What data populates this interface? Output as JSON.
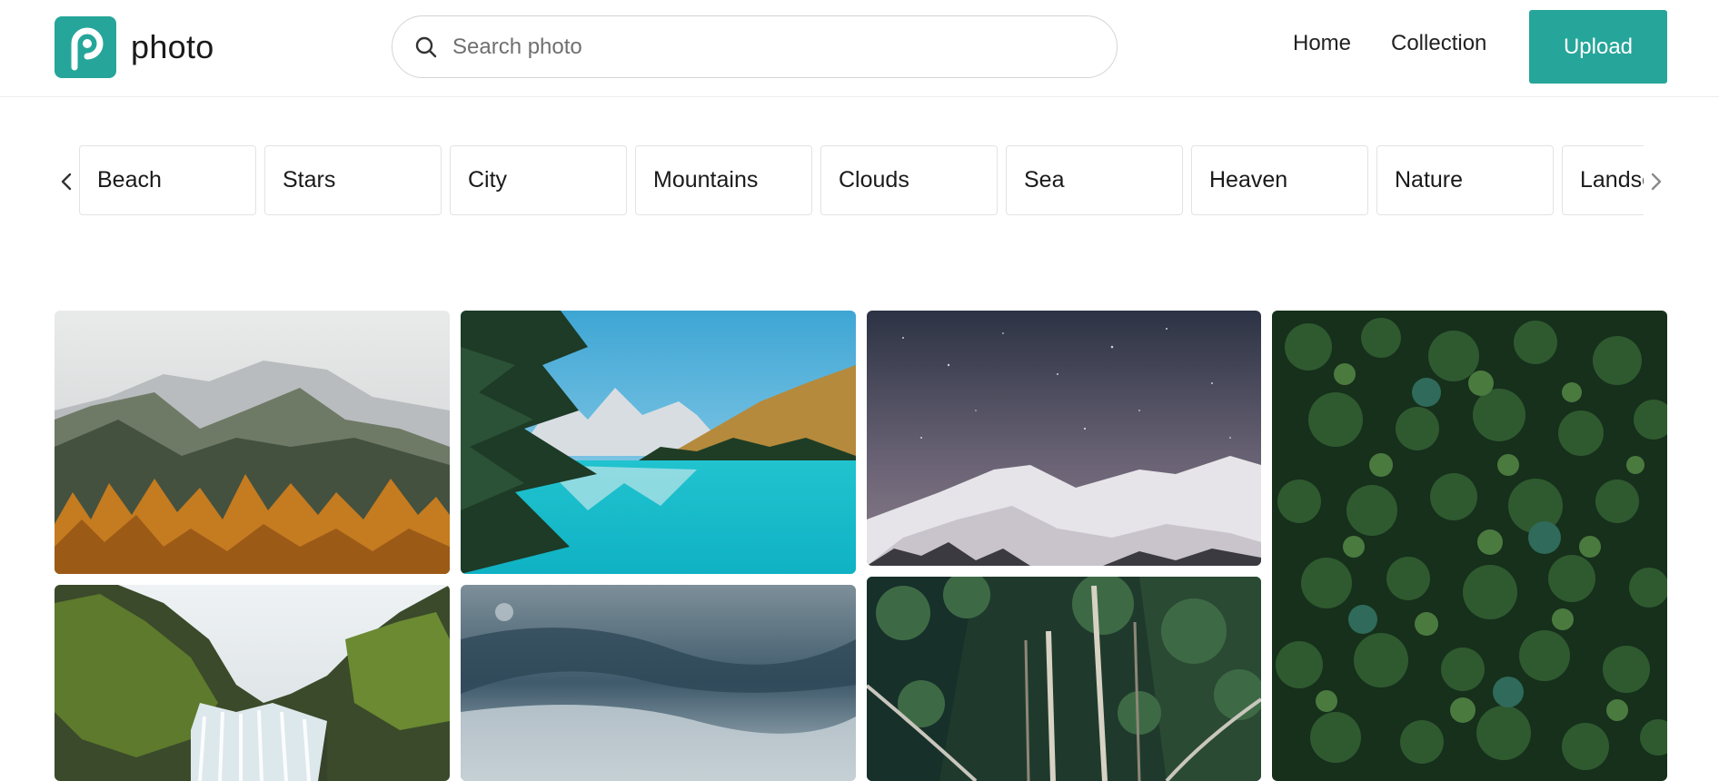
{
  "header": {
    "logo_text": "photo",
    "search_placeholder": "Search photo",
    "nav": {
      "home": "Home",
      "collection": "Collection"
    },
    "upload_label": "Upload"
  },
  "categories": [
    "Beach",
    "Stars",
    "City",
    "Mountains",
    "Clouds",
    "Sea",
    "Heaven",
    "Nature",
    "Landscape"
  ],
  "colors": {
    "accent": "#26a69a"
  },
  "icons": {
    "logo": "logo-p-icon",
    "search": "search-icon",
    "prev": "chevron-left-icon",
    "next": "chevron-right-icon"
  },
  "photos": [
    {
      "subject": "misty-mountains-autumn-forest"
    },
    {
      "subject": "turquoise-mountain-lake"
    },
    {
      "subject": "snowy-peaks-starry-night"
    },
    {
      "subject": "aerial-pine-forest"
    },
    {
      "subject": "mossy-cliffs-waterfall"
    },
    {
      "subject": "stormy-cloudy-sky"
    },
    {
      "subject": "forest-rope-bridge"
    }
  ]
}
